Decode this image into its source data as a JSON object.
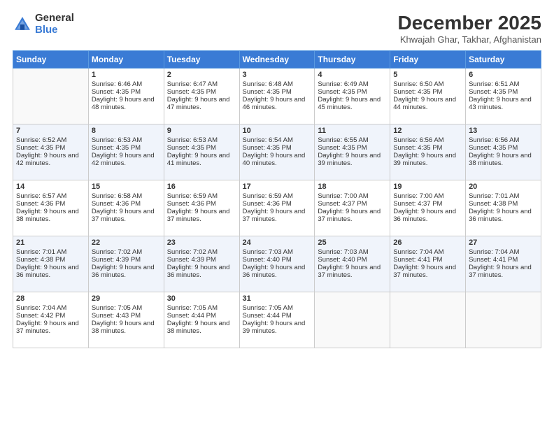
{
  "logo": {
    "general": "General",
    "blue": "Blue"
  },
  "title": "December 2025",
  "subtitle": "Khwajah Ghar, Takhar, Afghanistan",
  "days": [
    "Sunday",
    "Monday",
    "Tuesday",
    "Wednesday",
    "Thursday",
    "Friday",
    "Saturday"
  ],
  "weeks": [
    [
      {
        "num": "",
        "sunrise": "",
        "sunset": "",
        "daylight": ""
      },
      {
        "num": "1",
        "sunrise": "Sunrise: 6:46 AM",
        "sunset": "Sunset: 4:35 PM",
        "daylight": "Daylight: 9 hours and 48 minutes."
      },
      {
        "num": "2",
        "sunrise": "Sunrise: 6:47 AM",
        "sunset": "Sunset: 4:35 PM",
        "daylight": "Daylight: 9 hours and 47 minutes."
      },
      {
        "num": "3",
        "sunrise": "Sunrise: 6:48 AM",
        "sunset": "Sunset: 4:35 PM",
        "daylight": "Daylight: 9 hours and 46 minutes."
      },
      {
        "num": "4",
        "sunrise": "Sunrise: 6:49 AM",
        "sunset": "Sunset: 4:35 PM",
        "daylight": "Daylight: 9 hours and 45 minutes."
      },
      {
        "num": "5",
        "sunrise": "Sunrise: 6:50 AM",
        "sunset": "Sunset: 4:35 PM",
        "daylight": "Daylight: 9 hours and 44 minutes."
      },
      {
        "num": "6",
        "sunrise": "Sunrise: 6:51 AM",
        "sunset": "Sunset: 4:35 PM",
        "daylight": "Daylight: 9 hours and 43 minutes."
      }
    ],
    [
      {
        "num": "7",
        "sunrise": "Sunrise: 6:52 AM",
        "sunset": "Sunset: 4:35 PM",
        "daylight": "Daylight: 9 hours and 42 minutes."
      },
      {
        "num": "8",
        "sunrise": "Sunrise: 6:53 AM",
        "sunset": "Sunset: 4:35 PM",
        "daylight": "Daylight: 9 hours and 42 minutes."
      },
      {
        "num": "9",
        "sunrise": "Sunrise: 6:53 AM",
        "sunset": "Sunset: 4:35 PM",
        "daylight": "Daylight: 9 hours and 41 minutes."
      },
      {
        "num": "10",
        "sunrise": "Sunrise: 6:54 AM",
        "sunset": "Sunset: 4:35 PM",
        "daylight": "Daylight: 9 hours and 40 minutes."
      },
      {
        "num": "11",
        "sunrise": "Sunrise: 6:55 AM",
        "sunset": "Sunset: 4:35 PM",
        "daylight": "Daylight: 9 hours and 39 minutes."
      },
      {
        "num": "12",
        "sunrise": "Sunrise: 6:56 AM",
        "sunset": "Sunset: 4:35 PM",
        "daylight": "Daylight: 9 hours and 39 minutes."
      },
      {
        "num": "13",
        "sunrise": "Sunrise: 6:56 AM",
        "sunset": "Sunset: 4:35 PM",
        "daylight": "Daylight: 9 hours and 38 minutes."
      }
    ],
    [
      {
        "num": "14",
        "sunrise": "Sunrise: 6:57 AM",
        "sunset": "Sunset: 4:36 PM",
        "daylight": "Daylight: 9 hours and 38 minutes."
      },
      {
        "num": "15",
        "sunrise": "Sunrise: 6:58 AM",
        "sunset": "Sunset: 4:36 PM",
        "daylight": "Daylight: 9 hours and 37 minutes."
      },
      {
        "num": "16",
        "sunrise": "Sunrise: 6:59 AM",
        "sunset": "Sunset: 4:36 PM",
        "daylight": "Daylight: 9 hours and 37 minutes."
      },
      {
        "num": "17",
        "sunrise": "Sunrise: 6:59 AM",
        "sunset": "Sunset: 4:36 PM",
        "daylight": "Daylight: 9 hours and 37 minutes."
      },
      {
        "num": "18",
        "sunrise": "Sunrise: 7:00 AM",
        "sunset": "Sunset: 4:37 PM",
        "daylight": "Daylight: 9 hours and 37 minutes."
      },
      {
        "num": "19",
        "sunrise": "Sunrise: 7:00 AM",
        "sunset": "Sunset: 4:37 PM",
        "daylight": "Daylight: 9 hours and 36 minutes."
      },
      {
        "num": "20",
        "sunrise": "Sunrise: 7:01 AM",
        "sunset": "Sunset: 4:38 PM",
        "daylight": "Daylight: 9 hours and 36 minutes."
      }
    ],
    [
      {
        "num": "21",
        "sunrise": "Sunrise: 7:01 AM",
        "sunset": "Sunset: 4:38 PM",
        "daylight": "Daylight: 9 hours and 36 minutes."
      },
      {
        "num": "22",
        "sunrise": "Sunrise: 7:02 AM",
        "sunset": "Sunset: 4:39 PM",
        "daylight": "Daylight: 9 hours and 36 minutes."
      },
      {
        "num": "23",
        "sunrise": "Sunrise: 7:02 AM",
        "sunset": "Sunset: 4:39 PM",
        "daylight": "Daylight: 9 hours and 36 minutes."
      },
      {
        "num": "24",
        "sunrise": "Sunrise: 7:03 AM",
        "sunset": "Sunset: 4:40 PM",
        "daylight": "Daylight: 9 hours and 36 minutes."
      },
      {
        "num": "25",
        "sunrise": "Sunrise: 7:03 AM",
        "sunset": "Sunset: 4:40 PM",
        "daylight": "Daylight: 9 hours and 37 minutes."
      },
      {
        "num": "26",
        "sunrise": "Sunrise: 7:04 AM",
        "sunset": "Sunset: 4:41 PM",
        "daylight": "Daylight: 9 hours and 37 minutes."
      },
      {
        "num": "27",
        "sunrise": "Sunrise: 7:04 AM",
        "sunset": "Sunset: 4:41 PM",
        "daylight": "Daylight: 9 hours and 37 minutes."
      }
    ],
    [
      {
        "num": "28",
        "sunrise": "Sunrise: 7:04 AM",
        "sunset": "Sunset: 4:42 PM",
        "daylight": "Daylight: 9 hours and 37 minutes."
      },
      {
        "num": "29",
        "sunrise": "Sunrise: 7:05 AM",
        "sunset": "Sunset: 4:43 PM",
        "daylight": "Daylight: 9 hours and 38 minutes."
      },
      {
        "num": "30",
        "sunrise": "Sunrise: 7:05 AM",
        "sunset": "Sunset: 4:44 PM",
        "daylight": "Daylight: 9 hours and 38 minutes."
      },
      {
        "num": "31",
        "sunrise": "Sunrise: 7:05 AM",
        "sunset": "Sunset: 4:44 PM",
        "daylight": "Daylight: 9 hours and 39 minutes."
      },
      {
        "num": "",
        "sunrise": "",
        "sunset": "",
        "daylight": ""
      },
      {
        "num": "",
        "sunrise": "",
        "sunset": "",
        "daylight": ""
      },
      {
        "num": "",
        "sunrise": "",
        "sunset": "",
        "daylight": ""
      }
    ]
  ]
}
